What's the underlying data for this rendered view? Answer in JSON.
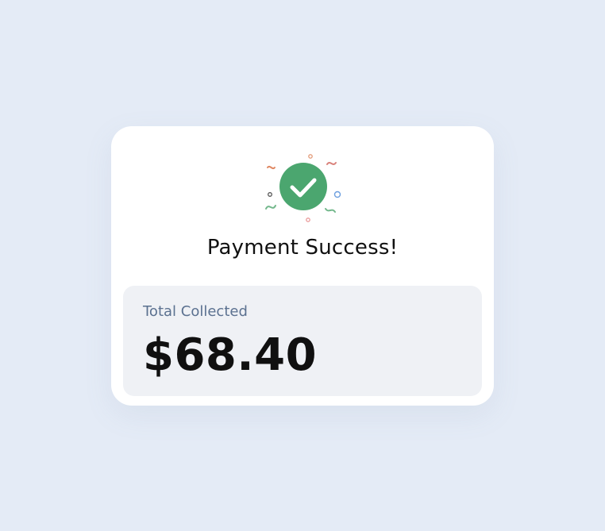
{
  "status": {
    "title": "Payment Success!",
    "icon": "check-circle-icon",
    "accent_color": "#4ba66f"
  },
  "summary": {
    "label": "Total Collected",
    "amount": "$68.40"
  }
}
